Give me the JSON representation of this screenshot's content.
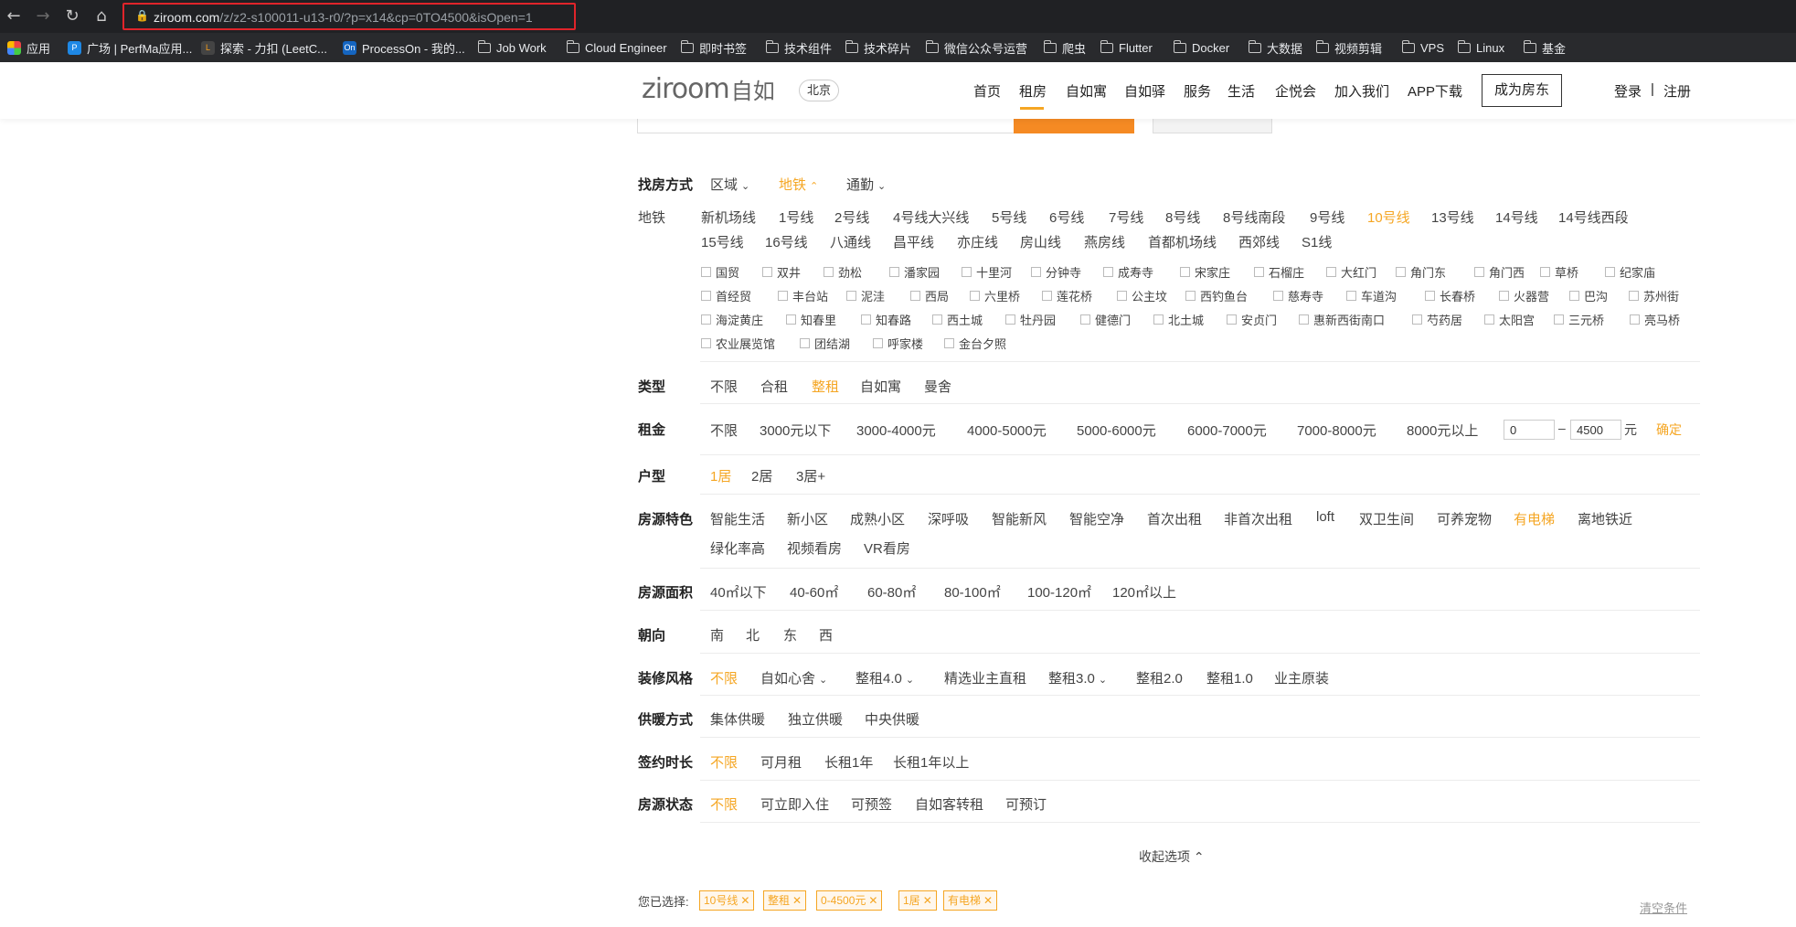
{
  "browser": {
    "url_domain": "ziroom.com",
    "url_path": "/z/z2-s100011-u13-r0/?p=x14&cp=0TO4500&isOpen=1",
    "bookmarks": [
      "应用",
      "广场 | PerfMa应用...",
      "探索 - 力扣 (LeetC...",
      "ProcessOn - 我的...",
      "Job Work",
      "Cloud Engineer",
      "即时书签",
      "技术组件",
      "技术碎片",
      "微信公众号运营",
      "爬虫",
      "Flutter",
      "Docker",
      "大数据",
      "视频剪辑",
      "VPS",
      "Linux",
      "基金"
    ]
  },
  "header": {
    "logo_latin": "ziroom",
    "logo_cn": "自如",
    "city": "北京",
    "nav": [
      "首页",
      "租房",
      "自如寓",
      "自如驿",
      "服务",
      "生活",
      "企悦会",
      "加入我们",
      "APP下载"
    ],
    "active_nav": "租房",
    "landlord_button": "成为房东",
    "login": "登录",
    "separator": "|",
    "register": "注册"
  },
  "filters": {
    "find_method": {
      "label": "找房方式",
      "options": [
        "区域",
        "地铁",
        "通勤"
      ],
      "selected": "地铁"
    },
    "subway": {
      "label": "地铁",
      "lines_row1": [
        "新机场线",
        "1号线",
        "2号线",
        "4号线大兴线",
        "5号线",
        "6号线",
        "7号线",
        "8号线",
        "8号线南段",
        "9号线",
        "10号线",
        "13号线",
        "14号线",
        "14号线西段"
      ],
      "lines_row2": [
        "15号线",
        "16号线",
        "八通线",
        "昌平线",
        "亦庄线",
        "房山线",
        "燕房线",
        "首都机场线",
        "西郊线",
        "S1线"
      ],
      "selected_line": "10号线",
      "stations_row1": [
        "国贸",
        "双井",
        "劲松",
        "潘家园",
        "十里河",
        "分钟寺",
        "成寿寺",
        "宋家庄",
        "石榴庄",
        "大红门",
        "角门东",
        "角门西",
        "草桥",
        "纪家庙"
      ],
      "stations_row2": [
        "首经贸",
        "丰台站",
        "泥洼",
        "西局",
        "六里桥",
        "莲花桥",
        "公主坟",
        "西钓鱼台",
        "慈寿寺",
        "车道沟",
        "长春桥",
        "火器营",
        "巴沟",
        "苏州街"
      ],
      "stations_row3": [
        "海淀黄庄",
        "知春里",
        "知春路",
        "西土城",
        "牡丹园",
        "健德门",
        "北土城",
        "安贞门",
        "惠新西街南口",
        "芍药居",
        "太阳宫",
        "三元桥",
        "亮马桥"
      ],
      "stations_row4": [
        "农业展览馆",
        "团结湖",
        "呼家楼",
        "金台夕照"
      ]
    },
    "type": {
      "label": "类型",
      "options": [
        "不限",
        "合租",
        "整租",
        "自如寓",
        "曼舍"
      ],
      "selected": "整租"
    },
    "rent": {
      "label": "租金",
      "options": [
        "不限",
        "3000元以下",
        "3000-4000元",
        "4000-5000元",
        "5000-6000元",
        "6000-7000元",
        "7000-8000元",
        "8000元以上"
      ],
      "min": "0",
      "max": "4500",
      "dash": "–",
      "unit": "元",
      "confirm": "确定"
    },
    "layout": {
      "label": "户型",
      "options": [
        "1居",
        "2居",
        "3居+"
      ],
      "selected": "1居"
    },
    "features": {
      "label": "房源特色",
      "row1": [
        "智能生活",
        "新小区",
        "成熟小区",
        "深呼吸",
        "智能新风",
        "智能空净",
        "首次出租",
        "非首次出租",
        "loft",
        "双卫生间",
        "可养宠物",
        "有电梯",
        "离地铁近"
      ],
      "row2": [
        "绿化率高",
        "视频看房",
        "VR看房"
      ],
      "selected": "有电梯"
    },
    "area": {
      "label": "房源面积",
      "options": [
        "40㎡以下",
        "40-60㎡",
        "60-80㎡",
        "80-100㎡",
        "100-120㎡",
        "120㎡以上"
      ]
    },
    "orientation": {
      "label": "朝向",
      "options": [
        "南",
        "北",
        "东",
        "西"
      ]
    },
    "decoration": {
      "label": "装修风格",
      "options": [
        "不限",
        "自如心舍",
        "整租4.0",
        "精选业主直租",
        "整租3.0",
        "整租2.0",
        "整租1.0",
        "业主原装"
      ],
      "selected": "不限"
    },
    "heating": {
      "label": "供暖方式",
      "options": [
        "集体供暖",
        "独立供暖",
        "中央供暖"
      ]
    },
    "lease": {
      "label": "签约时长",
      "options": [
        "不限",
        "可月租",
        "长租1年",
        "长租1年以上"
      ],
      "selected": "不限"
    },
    "status": {
      "label": "房源状态",
      "options": [
        "不限",
        "可立即入住",
        "可预签",
        "自如客转租",
        "可预订"
      ],
      "selected": "不限"
    }
  },
  "collapse_label": "收起选项",
  "selected_summary": {
    "label": "您已选择:",
    "chips": [
      "10号线",
      "整租",
      "0-4500元",
      "1居",
      "有电梯"
    ],
    "clear": "清空条件"
  },
  "colors": {
    "accent": "#f5a623",
    "highlight_border": "#e0242a"
  }
}
